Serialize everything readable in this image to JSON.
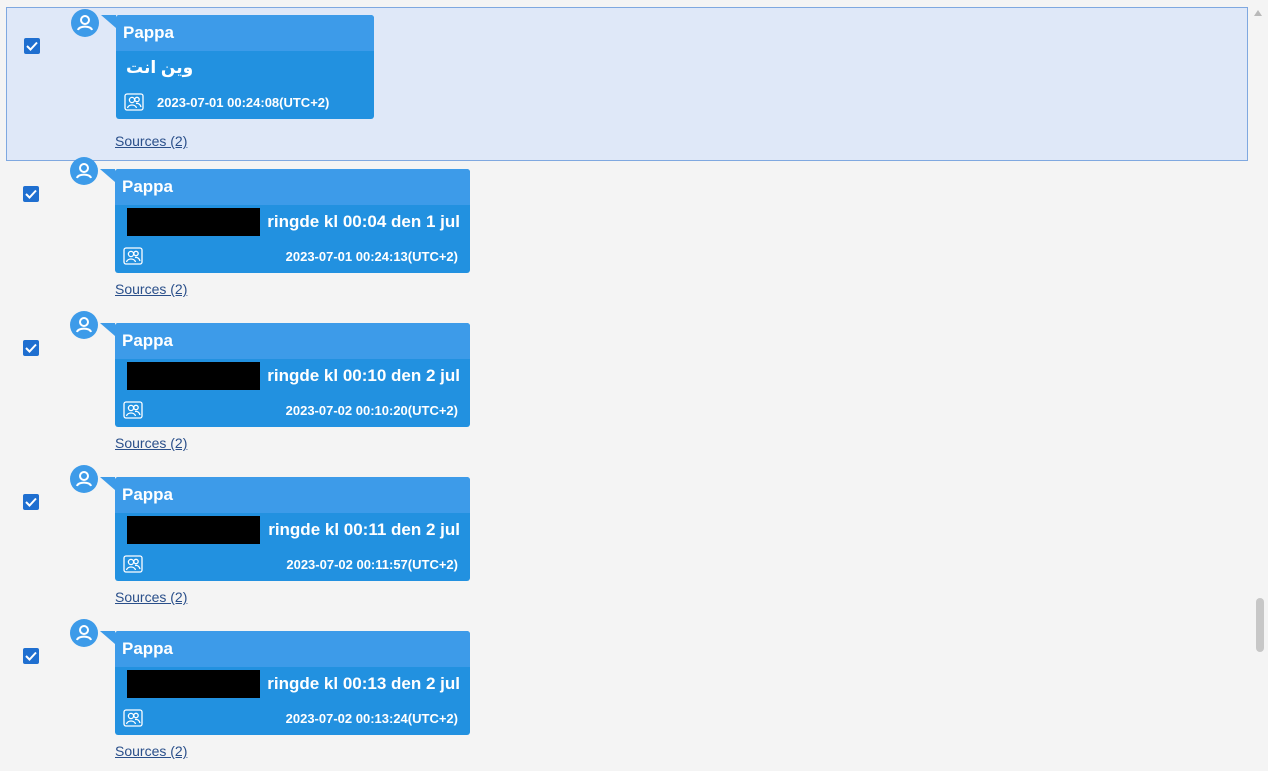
{
  "messages": [
    {
      "sender": "Pappa",
      "text": "وين انت",
      "timestamp": "2023-07-01 00:24:08(UTC+2)",
      "sources": "Sources (2)",
      "checked": true,
      "selected": true,
      "redacted": false
    },
    {
      "sender": "Pappa",
      "text": "ringde kl 00:04 den 1 jul",
      "timestamp": "2023-07-01 00:24:13(UTC+2)",
      "sources": "Sources (2)",
      "checked": true,
      "selected": false,
      "redacted": true
    },
    {
      "sender": "Pappa",
      "text": "ringde kl 00:10 den 2 jul",
      "timestamp": "2023-07-02 00:10:20(UTC+2)",
      "sources": "Sources (2)",
      "checked": true,
      "selected": false,
      "redacted": true
    },
    {
      "sender": "Pappa",
      "text": "ringde kl 00:11 den 2 jul",
      "timestamp": "2023-07-02 00:11:57(UTC+2)",
      "sources": "Sources (2)",
      "checked": true,
      "selected": false,
      "redacted": true
    },
    {
      "sender": "Pappa",
      "text": "ringde kl 00:13 den 2 jul",
      "timestamp": "2023-07-02 00:13:24(UTC+2)",
      "sources": "Sources (2)",
      "checked": true,
      "selected": false,
      "redacted": true
    }
  ],
  "icons": {
    "checkbox": "checkmark-icon",
    "avatar": "user-avatar-icon",
    "participants": "participants-icon"
  },
  "colors": {
    "bubble": "#2291e0",
    "bubble_header": "#3d9be9",
    "selection_bg": "#dfe8f8",
    "selection_border": "#7fa8e0",
    "checkbox": "#1f6fd0",
    "link": "#2a4f8a"
  }
}
